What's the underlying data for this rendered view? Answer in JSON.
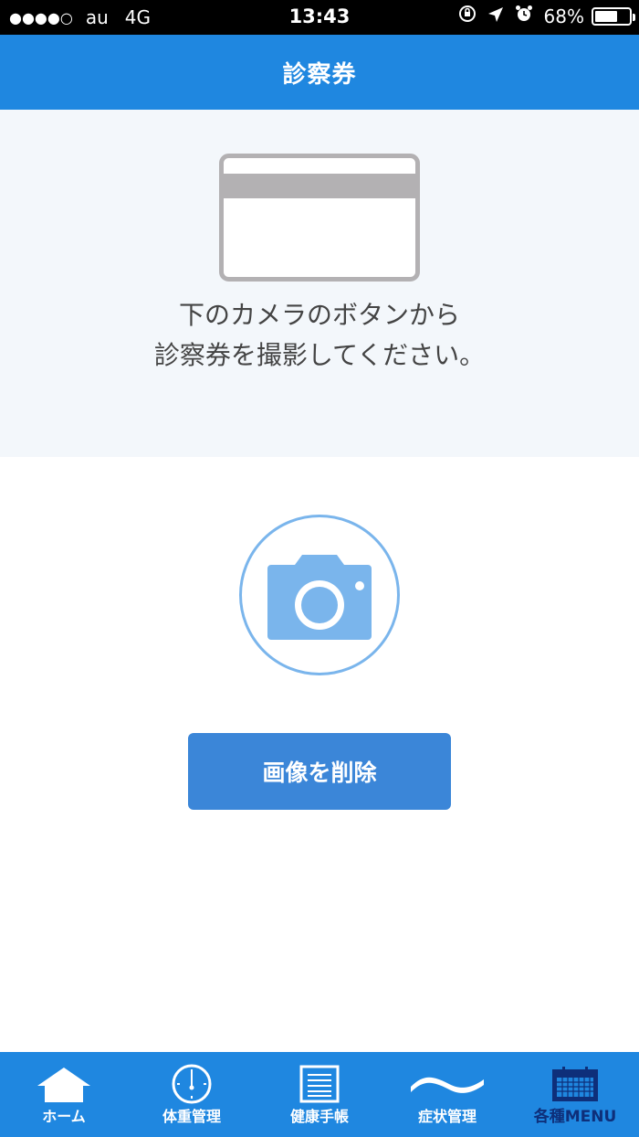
{
  "status_bar": {
    "signal": "●●●●○",
    "carrier": "au",
    "network": "4G",
    "time": "13:43",
    "battery": "68%",
    "battery_level": 0.68
  },
  "header": {
    "title": "診察券"
  },
  "instruction": {
    "line1": "下のカメラのボタンから",
    "line2": "診察券を撮影してください。"
  },
  "delete_button": {
    "label": "画像を削除"
  },
  "tabbar": {
    "items": [
      {
        "label": "ホーム",
        "icon": "home-icon"
      },
      {
        "label": "体重管理",
        "icon": "scale-icon"
      },
      {
        "label": "健康手帳",
        "icon": "notebook-icon"
      },
      {
        "label": "症状管理",
        "icon": "wave-icon"
      },
      {
        "label": "各種MENU",
        "icon": "calendar-icon"
      }
    ]
  },
  "colors": {
    "primary": "#1f87e0",
    "button": "#3b86d8",
    "camera": "#7ab5ec",
    "panel_bg": "#f3f7fb",
    "menu_label": "#0e2f7a"
  }
}
